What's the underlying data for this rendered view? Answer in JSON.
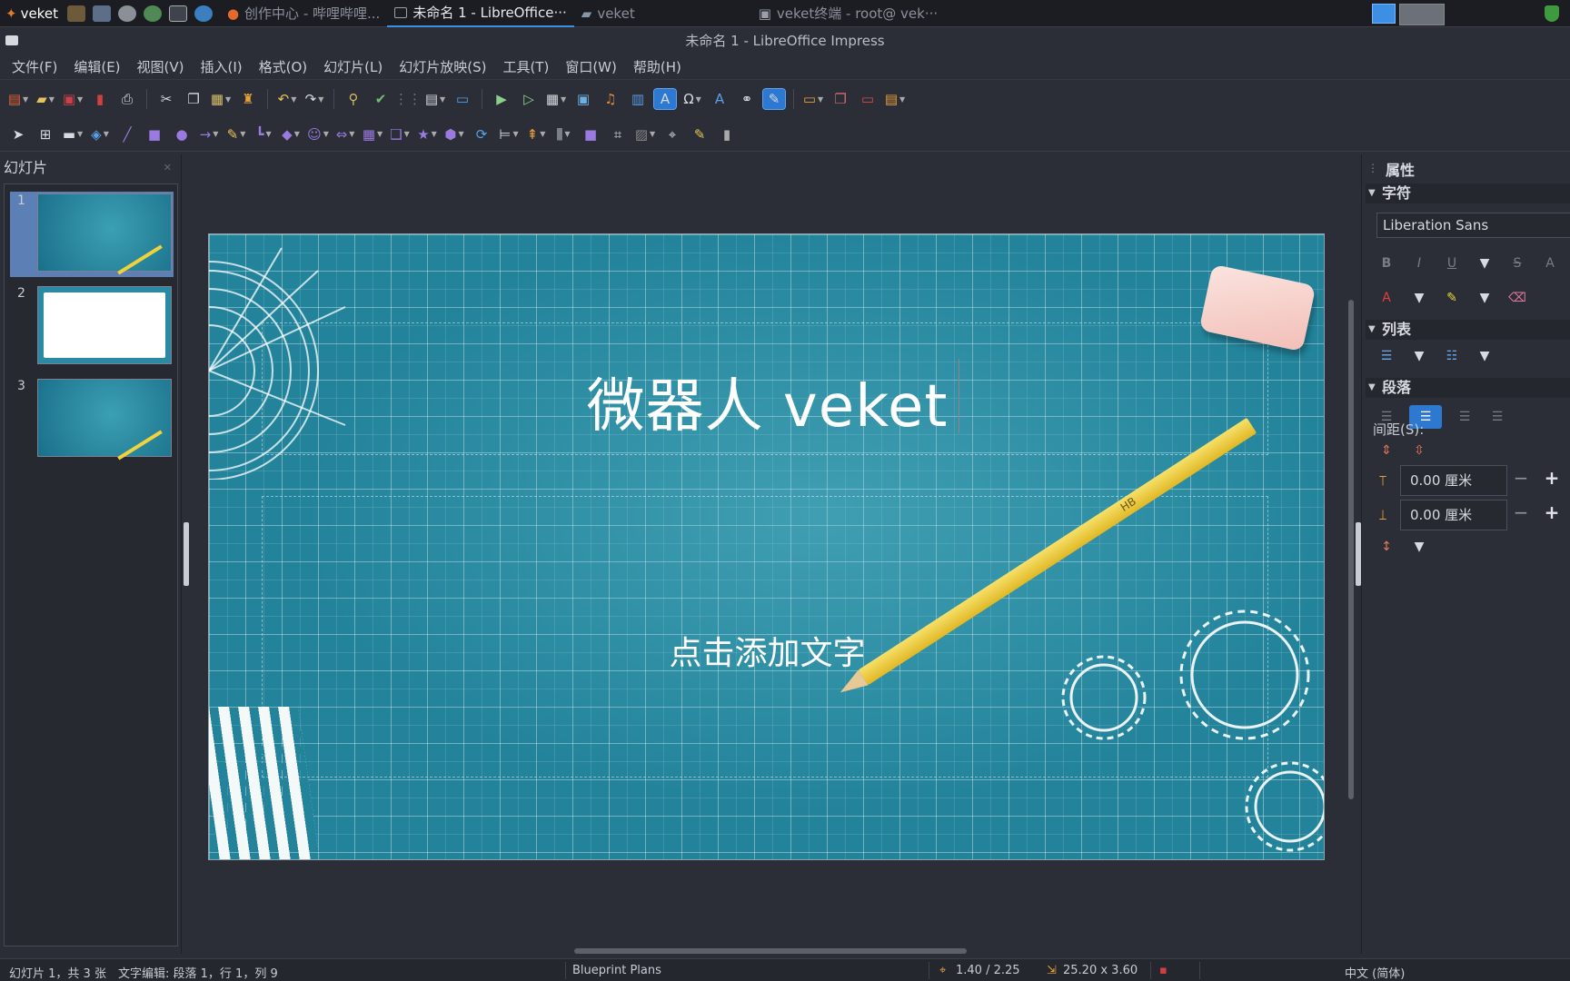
{
  "taskbar": {
    "start_label": "veket",
    "tasks": [
      {
        "label": "创作中心 - 哔哩哔哩...",
        "active": false
      },
      {
        "label": "未命名 1 - LibreOffice···",
        "active": true
      },
      {
        "label": "veket",
        "active": false
      },
      {
        "label": "veket终端 - root@ vek···",
        "active": false
      }
    ]
  },
  "window": {
    "title": "未命名 1 - LibreOffice Impress"
  },
  "menu": [
    "文件(F)",
    "编辑(E)",
    "视图(V)",
    "插入(I)",
    "格式(O)",
    "幻灯片(L)",
    "幻灯片放映(S)",
    "工具(T)",
    "窗口(W)",
    "帮助(H)"
  ],
  "slides_pane": {
    "title": "幻灯片",
    "slides": [
      {
        "number": "1",
        "selected": true,
        "kind": "blue"
      },
      {
        "number": "2",
        "selected": false,
        "kind": "white"
      },
      {
        "number": "3",
        "selected": false,
        "kind": "blue-text"
      }
    ]
  },
  "slide": {
    "title": "微器人 veket",
    "body_placeholder": "点击添加文字",
    "pencil_label": "HB"
  },
  "properties": {
    "title": "属性",
    "character_section": "字符",
    "font_name": "Liberation Sans",
    "list_section": "列表",
    "paragraph_section": "段落",
    "spacing_label": "间距(S):",
    "spacing_above": "0.00 厘米",
    "spacing_below": "0.00 厘米"
  },
  "status": {
    "slide_info": "幻灯片 1，共 3 张",
    "edit_info": "文字编辑: 段落 1，行 1，列 9",
    "master": "Blueprint Plans",
    "position": "1.40 / 2.25",
    "size": "25.20 x 3.60",
    "language": "中文 (简体)"
  },
  "colors": {
    "accent": "#2d78d1",
    "slide_bg": "#22839b",
    "chrome": "#2b2e36"
  }
}
